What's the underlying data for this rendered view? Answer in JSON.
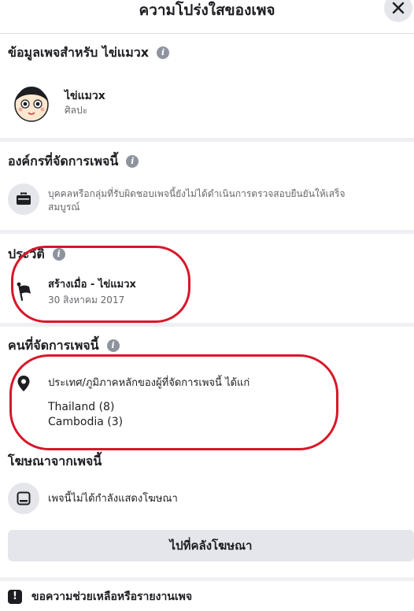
{
  "header": {
    "title": "ความโปร่งใสของเพจ",
    "close_icon": "close-icon"
  },
  "page_info": {
    "title": "ข้อมูลเพจสำหรับ ไข่แมวx",
    "page_name": "ไข่แมวx",
    "category": "ศิลปะ"
  },
  "organizations": {
    "title": "องค์กรที่จัดการเพจนี้",
    "description_line1": "บุคคลหรือกลุ่มที่รับผิดชอบเพจนี้ยังไม่ได้ดำเนินการตรวจสอบยืนยันให้เสร็จ",
    "description_line2": "สมบูรณ์"
  },
  "history": {
    "title": "ประวัติ",
    "event": "สร้างเมื่อ - ไข่แมวx",
    "date": "30 สิงหาคม 2017"
  },
  "managers": {
    "title": "คนที่จัดการเพจนี้",
    "location_label": "ประเทศ/ภูมิภาคหลักของผู้ที่จัดการเพจนี้ ได้แก่",
    "countries": [
      "Thailand (8)",
      "Cambodia (3)"
    ]
  },
  "ads": {
    "title": "โฆษณาจากเพจนี้",
    "status": "เพจนี้ไม่ได้กำลังแสดงโฆษณา",
    "library_button": "ไปที่คลังโฆษณา"
  },
  "report": {
    "label": "ขอความช่วยเหลือหรือรายงานเพจ"
  },
  "colors": {
    "annotation": "#d8182a",
    "text_primary": "#1c1e21",
    "text_secondary": "#65676b",
    "button_bg": "#e4e6eb"
  }
}
